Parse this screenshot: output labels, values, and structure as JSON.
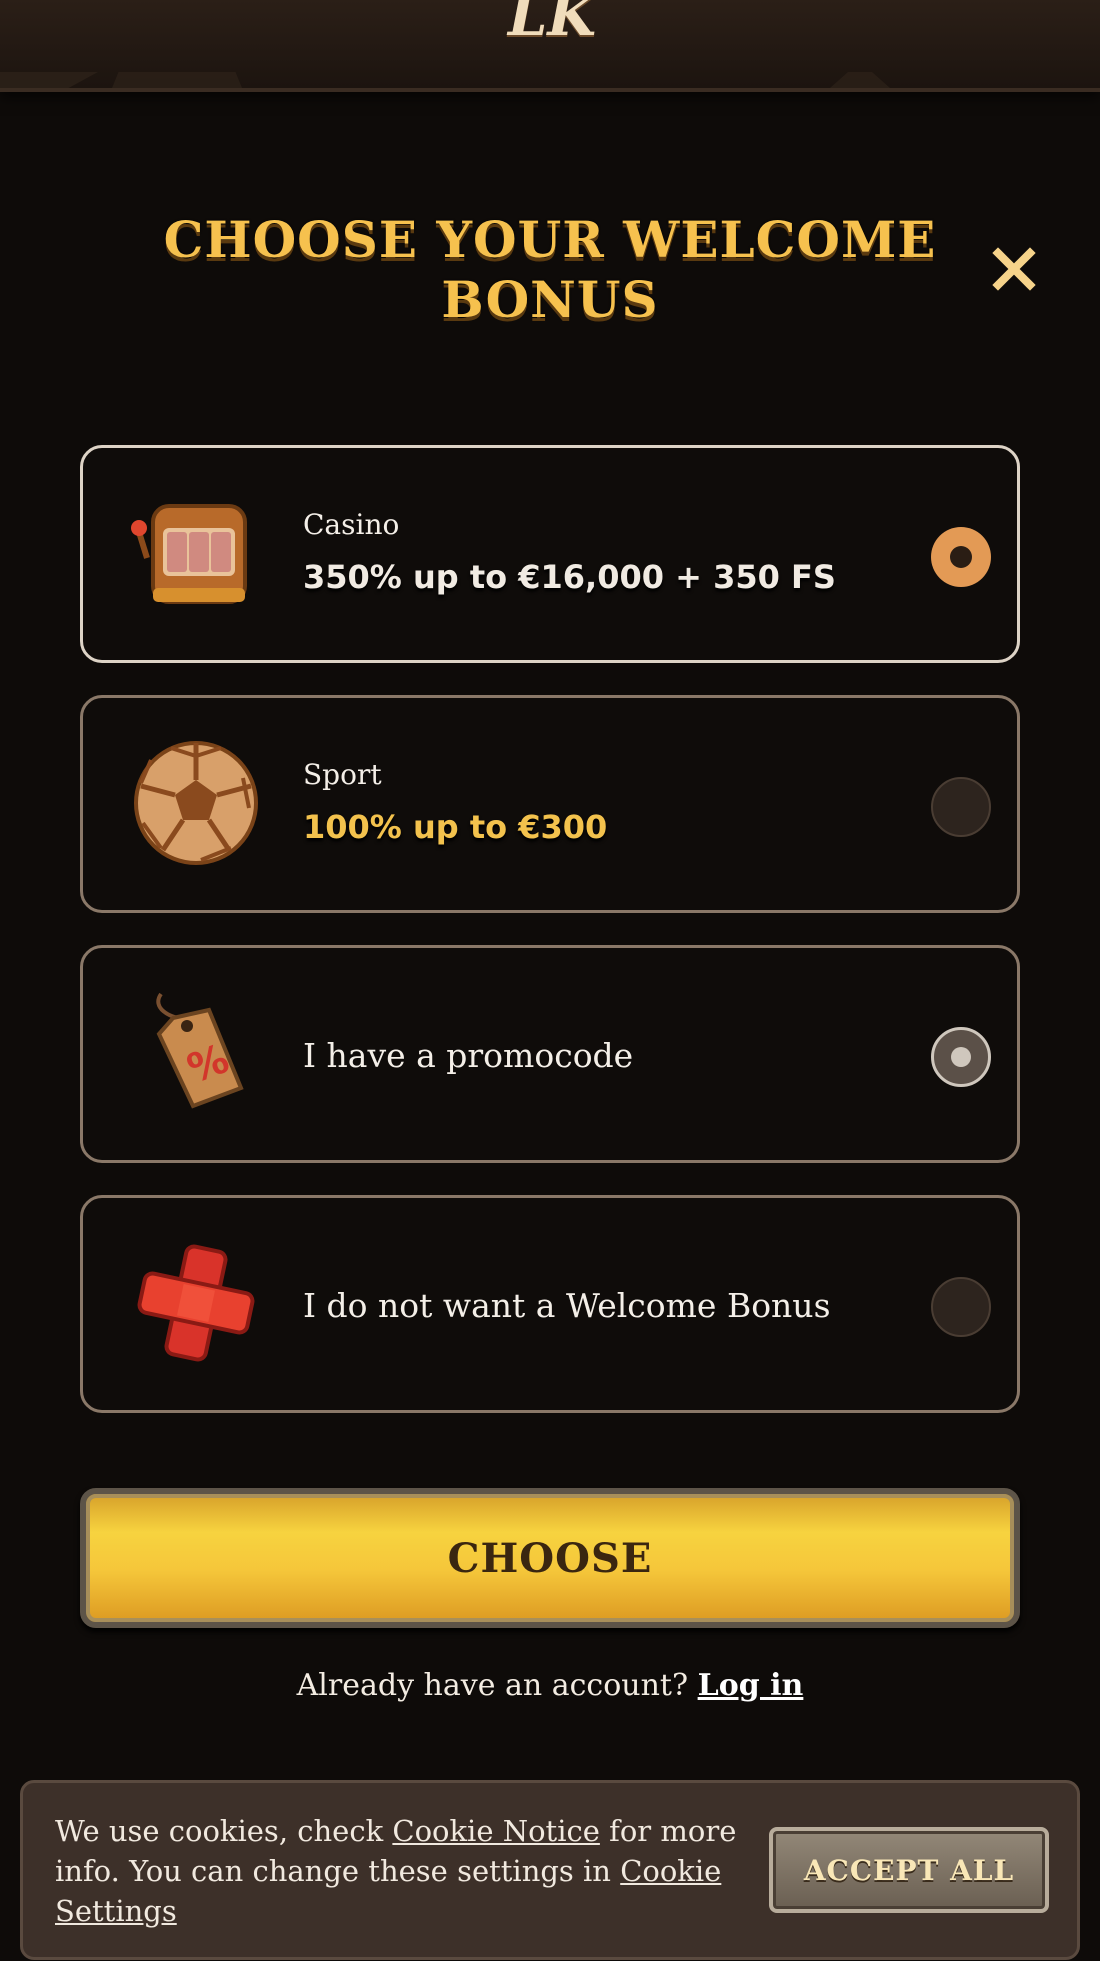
{
  "header": {
    "logo_text": "LK"
  },
  "modal": {
    "title": "CHOOSE YOUR WELCOME BONUS",
    "options": [
      {
        "category": "Casino",
        "value": "350% up to €16,000 + 350 FS",
        "icon": "slot-machine-icon",
        "state": "selected"
      },
      {
        "category": "Sport",
        "value": "100% up to €300",
        "icon": "soccer-ball-icon",
        "state": "unselected"
      },
      {
        "label": "I have a promocode",
        "icon": "price-tag-icon",
        "state": "hover"
      },
      {
        "label": "I do not want a Welcome Bonus",
        "icon": "red-cross-icon",
        "state": "unselected"
      }
    ],
    "choose_label": "CHOOSE",
    "account_prompt": "Already have an account?",
    "login_label": "Log in"
  },
  "cookie_banner": {
    "text_1": "We use cookies, check ",
    "link_notice": "Cookie Notice",
    "text_2": " for more info. You can change these settings in ",
    "link_settings": "Cookie Settings",
    "accept_label": "ACCEPT ALL"
  },
  "colors": {
    "background": "#0e0b09",
    "accent_gold": "#f6c14e",
    "selected_radio": "#e39a55"
  }
}
